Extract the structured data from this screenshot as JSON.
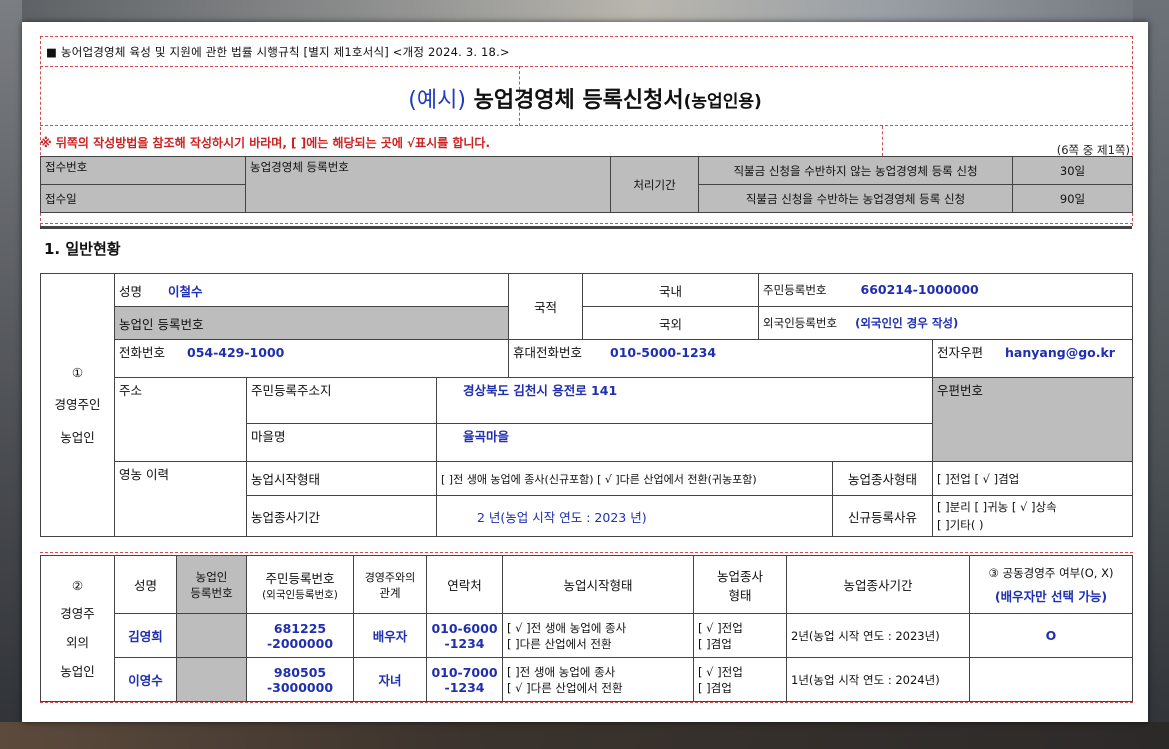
{
  "form": {
    "legal_basis": "■ 농어업경영체 육성 및 지원에 관한 법률 시행규칙 [별지 제1호서식] <개정 2024. 3. 18.>",
    "title_example": "(예시)",
    "title_main": "농업경영체 등록신청서",
    "title_sub": "(농업인용)",
    "notice": "※ 뒤쪽의 작성방법을 참조해 작성하시기 바라며, [ ]에는 해당되는 곳에 √표시를 합니다.",
    "page_no": "(6쪽 중 제1쪽)"
  },
  "receipt": {
    "receipt_no_label": "접수번호",
    "receipt_date_label": "접수일",
    "reg_no_label": "농업경영체 등록번호",
    "period_label": "처리기간",
    "without_subsidy": "직불금 신청을 수반하지 않는 농업경영체 등록 신청",
    "without_days": "30일",
    "with_subsidy": "직불금 신청을 수반하는 농업경영체 등록 신청",
    "with_days": "90일"
  },
  "section1": {
    "title": "1. 일반현황"
  },
  "main_farmer": {
    "group_no": "①",
    "group_l1": "경영주인",
    "group_l2": "농업인",
    "name_label": "성명",
    "name": "이철수",
    "farmer_reg_label": "농업인 등록번호",
    "nationality_label": "국적",
    "domestic_label": "국내",
    "foreign_label": "국외",
    "rrn_label": "주민등록번호",
    "rrn": "660214-1000000",
    "alien_label": "외국인등록번호",
    "alien_note": "(외국인인 경우 작성)",
    "phone_label": "전화번호",
    "phone": "054-429-1000",
    "mobile_label": "휴대전화번호",
    "mobile": "010-5000-1234",
    "email_label": "전자우편",
    "email": "hanyang@go.kr",
    "address_label": "주소",
    "reg_address_label": "주민등록주소지",
    "reg_address": "경상북도 김천시 용전로 141",
    "zip_label": "우편번호",
    "village_label": "마을명",
    "village": "율곡마을",
    "career_label": "영농 이력",
    "start_type_label": "농업시작형태",
    "start_type_value": "[ ]전 생애 농업에 종사(신규포함) [ √ ]다른 산업에서 전환(귀농포함)",
    "engage_type_label": "농업종사형태",
    "engage_type_value": "[ ]전업 [ √ ]겸업",
    "period_label": "농업종사기간",
    "period_value": "2 년(농업 시작 연도 : 2023 년)",
    "new_reason_label": "신규등록사유",
    "new_reason_l1": "[ ]분리 [ ]귀농 [ √ ]상속",
    "new_reason_l2": "[ ]기타(         )"
  },
  "other_farmers": {
    "group_no": "②",
    "group_l1": "경영주",
    "group_l2": "외의",
    "group_l3": "농업인",
    "headers": {
      "name": "성명",
      "reg_no_l1": "농업인",
      "reg_no_l2": "등록번호",
      "rrn_l1": "주민등록번호",
      "rrn_l2": "(외국인등록번호)",
      "relation_l1": "경영주와의",
      "relation_l2": "관계",
      "contact": "연락처",
      "start_type": "농업시작형태",
      "engage_l1": "농업종사",
      "engage_l2": "형태",
      "period": "농업종사기간",
      "joint_l1": "③ 공동경영주 여부(O, X)",
      "joint_l2": "(배우자만 선택 가능)"
    },
    "rows": [
      {
        "name": "김영희",
        "rrn_l1": "681225",
        "rrn_l2": "-2000000",
        "relation": "배우자",
        "contact_l1": "010-6000",
        "contact_l2": "-1234",
        "start_l1": "[ √ ]전 생애 농업에 종사",
        "start_l2": "[ ]다른 산업에서 전환",
        "engage_l1": "[ √ ]전업",
        "engage_l2": "[ ]겸업",
        "period": "2년(농업 시작 연도 : 2023년)",
        "joint": "O"
      },
      {
        "name": "이영수",
        "rrn_l1": "980505",
        "rrn_l2": "-3000000",
        "relation": "자녀",
        "contact_l1": "010-7000",
        "contact_l2": "-1234",
        "start_l1": "[ ]전 생애 농업에 종사",
        "start_l2": "[ √ ]다른 산업에서 전환",
        "engage_l1": "[ √ ]전업",
        "engage_l2": "[ ]겸업",
        "period": "1년(농업 시작 연도 : 2024년)",
        "joint": ""
      }
    ]
  }
}
